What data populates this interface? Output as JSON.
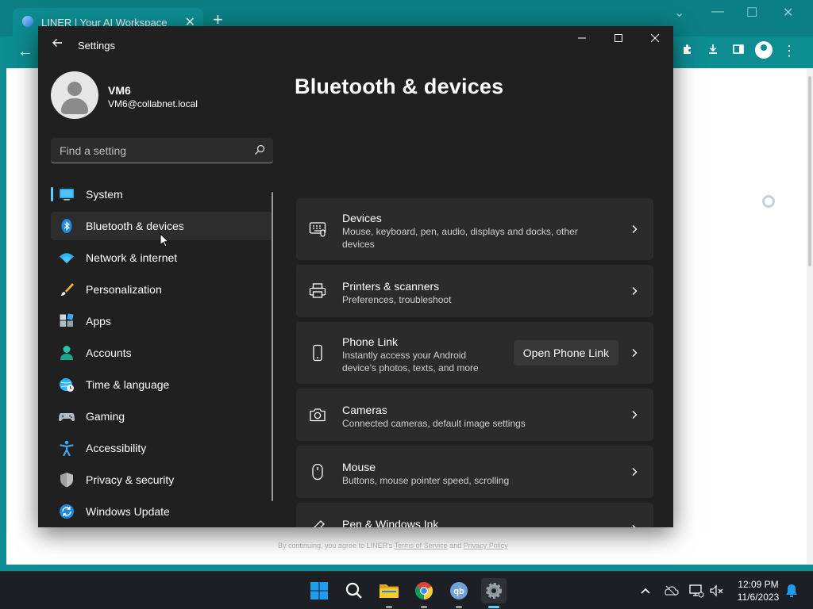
{
  "browser": {
    "tab_title": "LINER | Your AI Workspace",
    "tab_close": "✕",
    "new_tab": "+",
    "footer_prefix": "By continuing, you agree to LINER's",
    "footer_terms": "Terms of Service",
    "footer_and": "and",
    "footer_privacy": "Privacy Policy"
  },
  "settings": {
    "window_title": "Settings",
    "user": {
      "name": "VM6",
      "email": "VM6@collabnet.local"
    },
    "search": {
      "placeholder": "Find a setting"
    },
    "page_title": "Bluetooth & devices",
    "nav": [
      {
        "label": "System",
        "icon": "system-icon"
      },
      {
        "label": "Bluetooth & devices",
        "icon": "bluetooth-icon",
        "active": true
      },
      {
        "label": "Network & internet",
        "icon": "wifi-icon"
      },
      {
        "label": "Personalization",
        "icon": "brush-icon"
      },
      {
        "label": "Apps",
        "icon": "apps-icon"
      },
      {
        "label": "Accounts",
        "icon": "person-icon"
      },
      {
        "label": "Time & language",
        "icon": "globe-clock-icon"
      },
      {
        "label": "Gaming",
        "icon": "gamepad-icon"
      },
      {
        "label": "Accessibility",
        "icon": "accessibility-icon"
      },
      {
        "label": "Privacy & security",
        "icon": "shield-icon"
      },
      {
        "label": "Windows Update",
        "icon": "update-icon"
      }
    ],
    "cards": [
      {
        "title": "Devices",
        "desc": "Mouse, keyboard, pen, audio, displays and docks, other devices",
        "icon": "devices-icon"
      },
      {
        "title": "Printers & scanners",
        "desc": "Preferences, troubleshoot",
        "icon": "printer-icon"
      },
      {
        "title": "Phone Link",
        "desc": "Instantly access your Android device's photos, texts, and more",
        "icon": "phone-icon",
        "button": "Open Phone Link"
      },
      {
        "title": "Cameras",
        "desc": "Connected cameras, default image settings",
        "icon": "camera-icon"
      },
      {
        "title": "Mouse",
        "desc": "Buttons, mouse pointer speed, scrolling",
        "icon": "mouse-icon"
      },
      {
        "title": "Pen & Windows Ink",
        "desc": "",
        "icon": "pen-icon"
      }
    ]
  },
  "taskbar": {
    "apps": [
      "start-icon",
      "search-icon",
      "file-explorer-icon",
      "chrome-icon",
      "qbittorrent-icon",
      "settings-gear-icon"
    ],
    "time": "12:09 PM",
    "date": "11/6/2023"
  },
  "colors": {
    "accent": "#60cdff",
    "settings_bg": "#202020",
    "card_bg": "#2b2b2b",
    "browser_teal": "#0d8c91",
    "taskbar_bg": "#1c1f24"
  }
}
